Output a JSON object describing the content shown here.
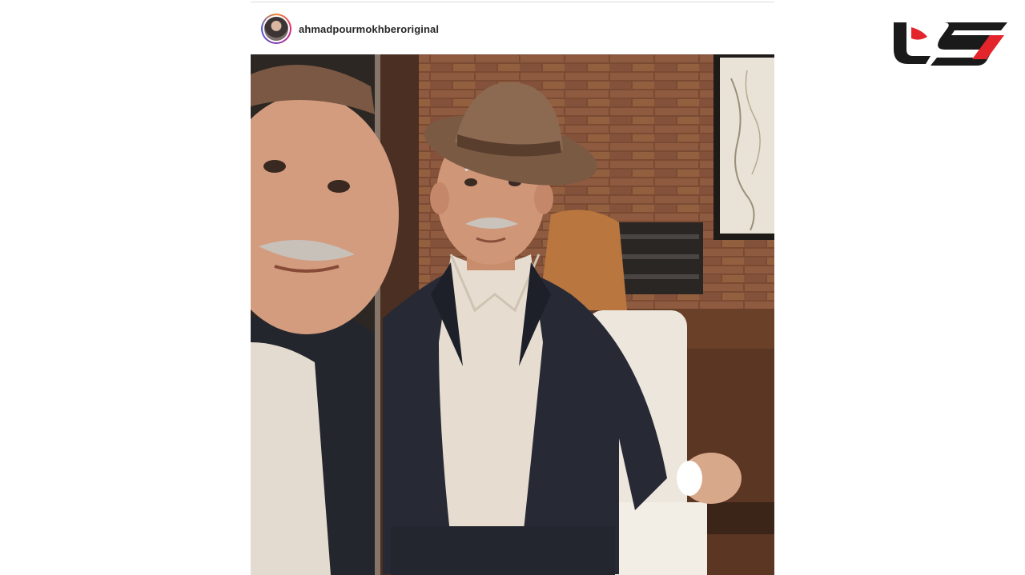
{
  "post": {
    "username": "ahmadpourmokhberoriginal",
    "avatar_icon": "profile-avatar",
    "photo_icon": "photo-two-elderly-man-selfie"
  },
  "brand": {
    "logo_icon": "site-logo",
    "colors": {
      "red": "#e3242b",
      "dark": "#1a1a1a"
    }
  }
}
